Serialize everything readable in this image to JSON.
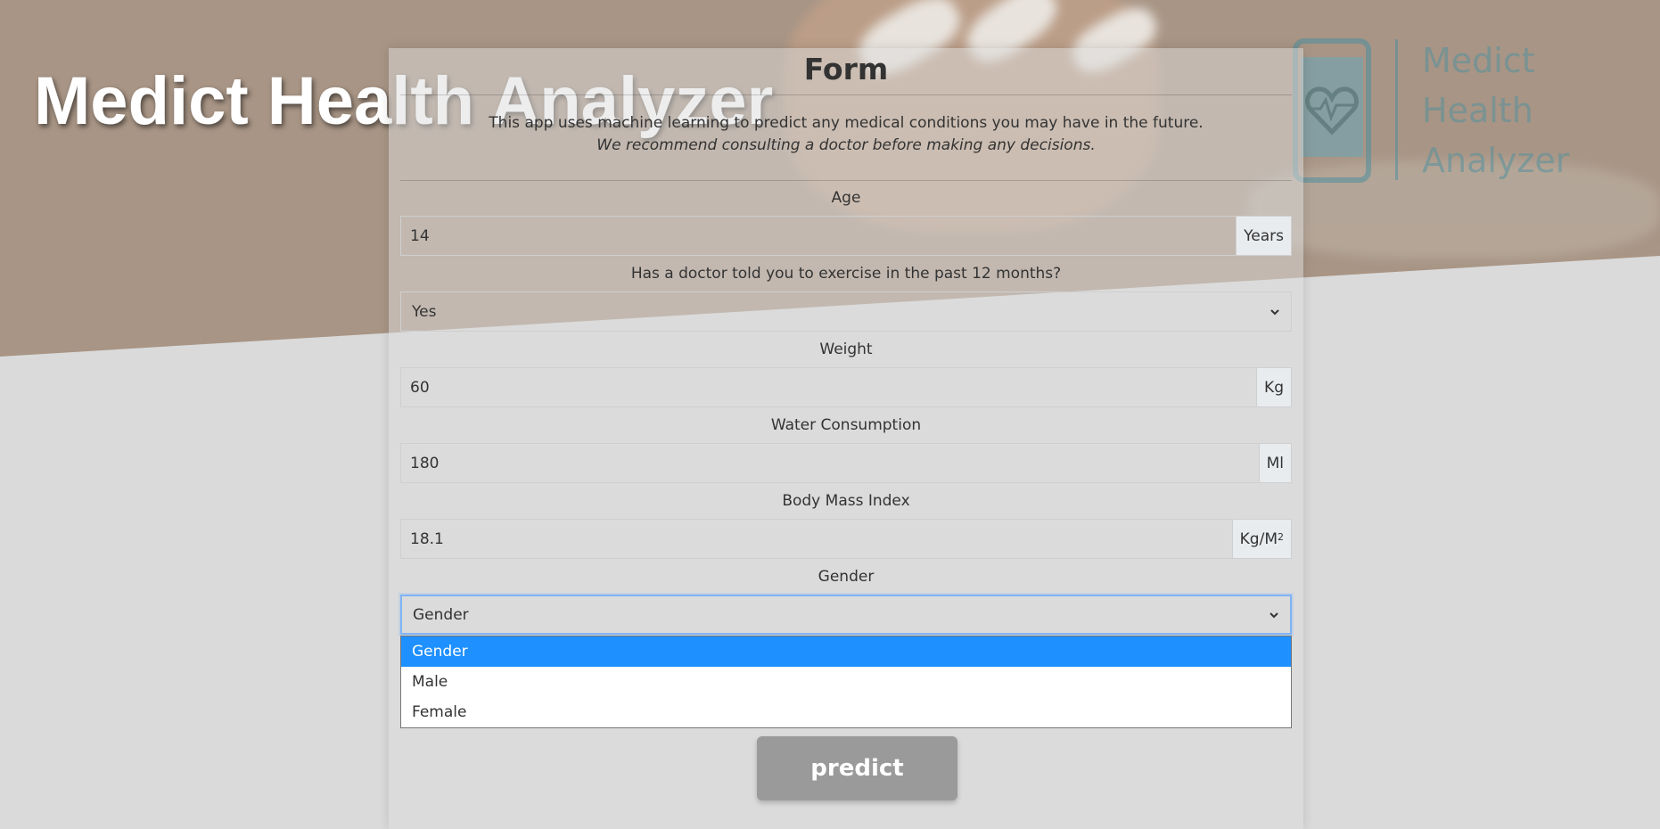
{
  "header": {
    "title": "Medict Health Analyzer"
  },
  "logo": {
    "line1": "Medict",
    "line2": "Health",
    "line3": "Analyzer",
    "color": "#56919e"
  },
  "form": {
    "title": "Form",
    "description": "This app uses machine learning to predict any medical conditions you may have in the future.",
    "recommendation": "We recommend consulting a doctor before making any decisions.",
    "fields": {
      "age": {
        "label": "Age",
        "value": "14",
        "unit": "Years"
      },
      "exercise": {
        "label": "Has a doctor told you to exercise in the past 12 months?",
        "selected": "Yes"
      },
      "weight": {
        "label": "Weight",
        "value": "60",
        "unit": "Kg"
      },
      "water": {
        "label": "Water Consumption",
        "value": "180",
        "unit": "Ml"
      },
      "bmi": {
        "label": "Body Mass Index",
        "value": "18.1",
        "unit": "Kg/M",
        "unit_sup": "2"
      },
      "gender": {
        "label": "Gender",
        "selected": "Gender",
        "options": [
          "Gender",
          "Male",
          "Female"
        ],
        "highlight_color": "#1e90ff"
      }
    },
    "submit_label": "predict"
  }
}
